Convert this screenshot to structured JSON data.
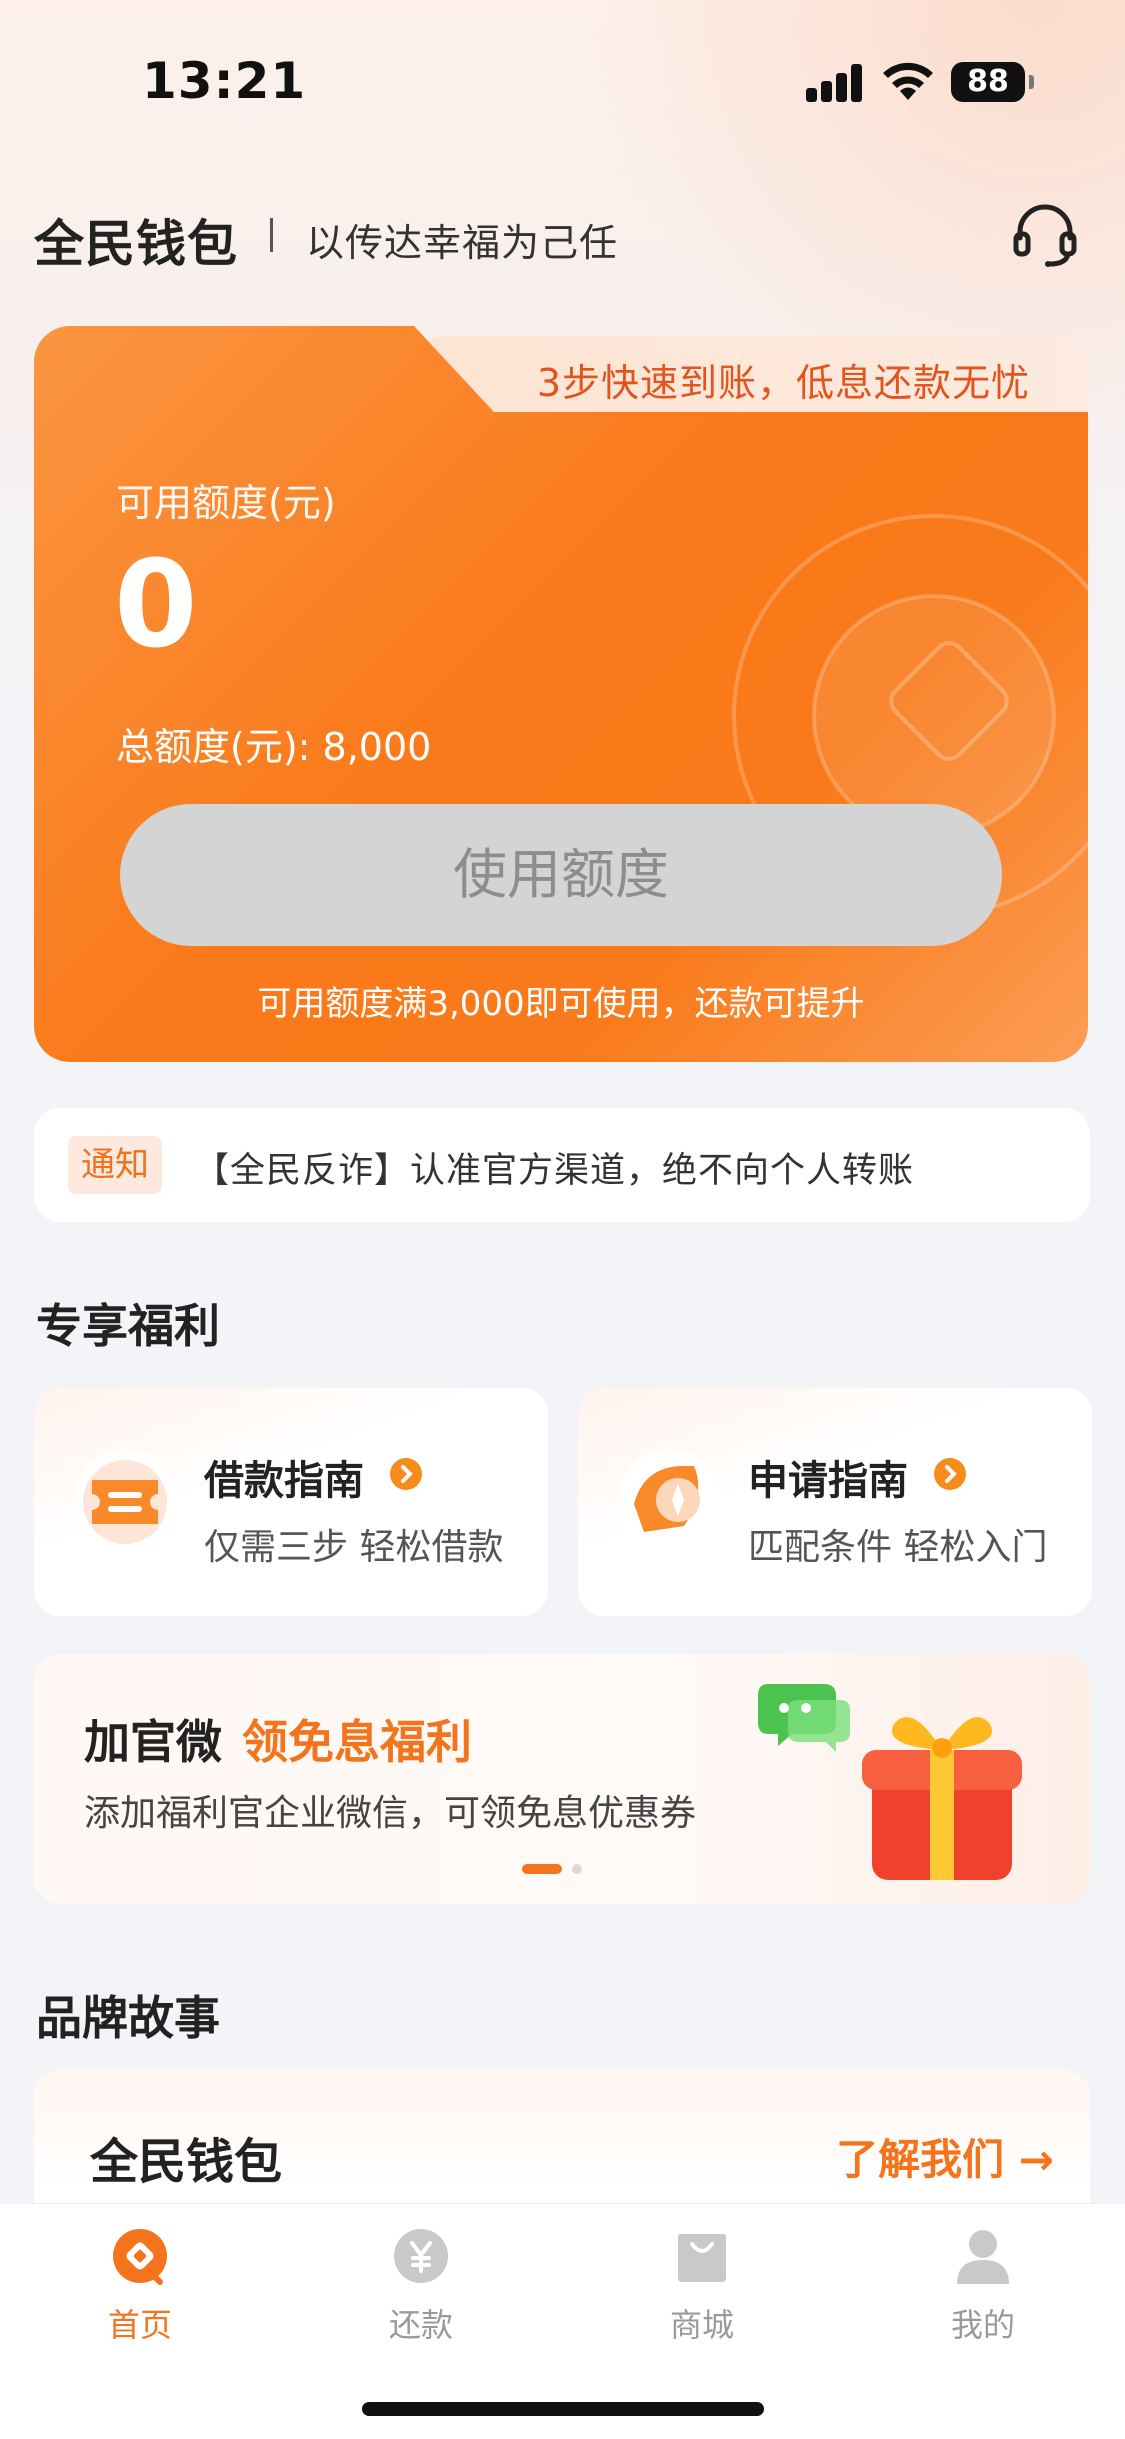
{
  "status_bar": {
    "time": "13:21",
    "battery": "88"
  },
  "header": {
    "brand": "全民钱包",
    "slogan": "以传达幸福为己任",
    "support_icon": "headset-icon"
  },
  "credit_card": {
    "tab_text": "3步快速到账，低息还款无忧",
    "available_label": "可用额度(元)",
    "available_amount": "0",
    "total_label": "总额度(元): 8,000",
    "use_button": "使用额度",
    "hint": "可用额度满3,000即可使用，还款可提升"
  },
  "notice": {
    "tag": "通知",
    "text": "【全民反诈】认准官方渠道，绝不向个人转账"
  },
  "benefits": {
    "title": "专享福利",
    "guides": [
      {
        "title": "借款指南",
        "subtitle": "仅需三步 轻松借款",
        "icon": "ticket-icon"
      },
      {
        "title": "申请指南",
        "subtitle": "匹配条件 轻松入门",
        "icon": "compass-icon"
      }
    ],
    "banner": {
      "title_plain": "加官微",
      "title_highlight": "领免息福利",
      "subtitle": "添加福利官企业微信，可领免息优惠券",
      "active_slide": 1,
      "slide_count": 2
    }
  },
  "brand_story": {
    "title": "品牌故事",
    "card_title": "全民钱包",
    "link": "了解我们 →"
  },
  "tab_bar": {
    "items": [
      {
        "label": "首页",
        "icon": "home-icon",
        "active": true
      },
      {
        "label": "还款",
        "icon": "yuan-coin-icon",
        "active": false
      },
      {
        "label": "商城",
        "icon": "shopping-bag-icon",
        "active": false
      },
      {
        "label": "我的",
        "icon": "user-icon",
        "active": false
      }
    ]
  },
  "colors": {
    "accent": "#f4741d",
    "card_orange": "#fa7a1b",
    "button_disabled": "#d4d4d4"
  }
}
